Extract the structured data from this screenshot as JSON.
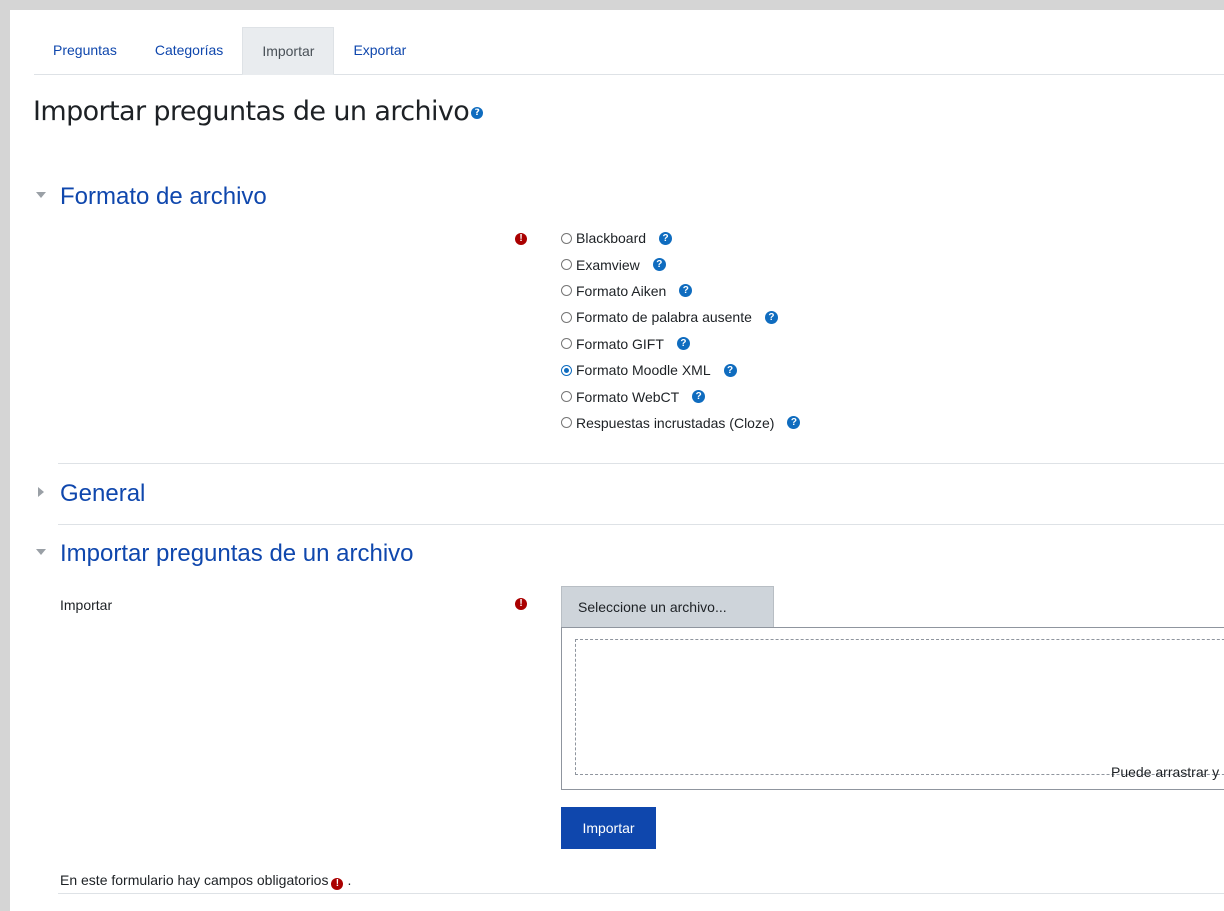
{
  "tabs": [
    {
      "label": "Preguntas",
      "active": false
    },
    {
      "label": "Categorías",
      "active": false
    },
    {
      "label": "Importar",
      "active": true
    },
    {
      "label": "Exportar",
      "active": false
    }
  ],
  "page_title": "Importar preguntas de un archivo",
  "icons": {
    "help": "question-circle-icon",
    "required": "exclamation-circle-icon",
    "collapse": "caret-down-icon",
    "expand": "caret-right-icon"
  },
  "sections": {
    "format": {
      "title": "Formato de archivo",
      "expanded": true,
      "options": [
        {
          "label": "Blackboard",
          "checked": false
        },
        {
          "label": "Examview",
          "checked": false
        },
        {
          "label": "Formato Aiken",
          "checked": false
        },
        {
          "label": "Formato de palabra ausente",
          "checked": false
        },
        {
          "label": "Formato GIFT",
          "checked": false
        },
        {
          "label": "Formato Moodle XML",
          "checked": true
        },
        {
          "label": "Formato WebCT",
          "checked": false
        },
        {
          "label": "Respuestas incrustadas (Cloze)",
          "checked": false
        }
      ]
    },
    "general": {
      "title": "General",
      "expanded": false
    },
    "import": {
      "title": "Importar preguntas de un archivo",
      "expanded": true,
      "field_label": "Importar",
      "choose_button": "Seleccione un archivo...",
      "drop_hint": "Puede arrastrar y"
    }
  },
  "submit_button": "Importar",
  "required_note": "En este formulario hay campos obligatorios",
  "required_note_end": ".",
  "colors": {
    "link": "#0f47ad",
    "help": "#0f6cbf",
    "required": "#aa0000",
    "primary_button": "#0f47ad"
  }
}
